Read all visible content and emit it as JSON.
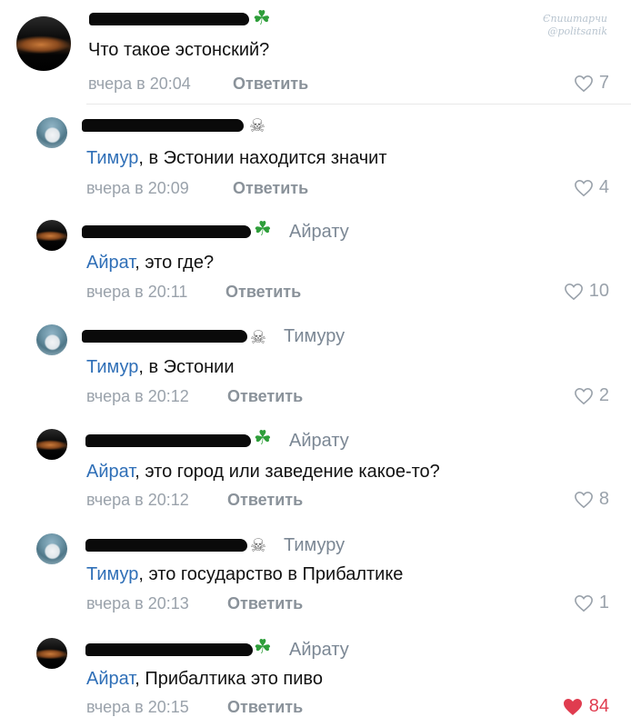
{
  "watermark": {
    "line1": "Єпиштарчи",
    "line2": "@politsanik"
  },
  "comments": [
    {
      "type": "main",
      "avatar": "sunset",
      "emoji": "clover-icon",
      "reply_to": "",
      "mention": "",
      "text": "Что такое эстонский?",
      "time": "вчера в 20:04",
      "reply_label": "Ответить",
      "likes": "7",
      "liked": false
    },
    {
      "type": "reply",
      "avatar": "anime",
      "emoji": "skull-icon",
      "reply_to": "",
      "mention": "Тимур",
      "text": ", в Эстонии находится значит",
      "time": "вчера в 20:09",
      "reply_label": "Ответить",
      "likes": "4",
      "liked": false
    },
    {
      "type": "reply",
      "avatar": "sunset",
      "emoji": "clover-icon",
      "reply_to": "Айрату",
      "mention": "Айрат",
      "text": ", это где?",
      "time": "вчера в 20:11",
      "reply_label": "Ответить",
      "likes": "10",
      "liked": false
    },
    {
      "type": "reply",
      "avatar": "anime",
      "emoji": "skull-icon",
      "reply_to": "Тимуру",
      "mention": "Тимур",
      "text": ", в Эстонии",
      "time": "вчера в 20:12",
      "reply_label": "Ответить",
      "likes": "2",
      "liked": false
    },
    {
      "type": "reply",
      "avatar": "sunset",
      "emoji": "clover-icon",
      "reply_to": "Айрату",
      "mention": "Айрат",
      "text": ", это город или заведение какое-то?",
      "time": "вчера в 20:12",
      "reply_label": "Ответить",
      "likes": "8",
      "liked": false
    },
    {
      "type": "reply",
      "avatar": "anime",
      "emoji": "skull-icon",
      "reply_to": "Тимуру",
      "mention": "Тимур",
      "text": ", это государство в Прибалтике",
      "time": "вчера в 20:13",
      "reply_label": "Ответить",
      "likes": "1",
      "liked": false
    },
    {
      "type": "reply",
      "avatar": "sunset",
      "emoji": "clover-icon",
      "reply_to": "Айрату",
      "mention": "Айрат",
      "text": ", Прибалтика это пиво",
      "time": "вчера в 20:15",
      "reply_label": "Ответить",
      "likes": "84",
      "liked": true
    }
  ]
}
